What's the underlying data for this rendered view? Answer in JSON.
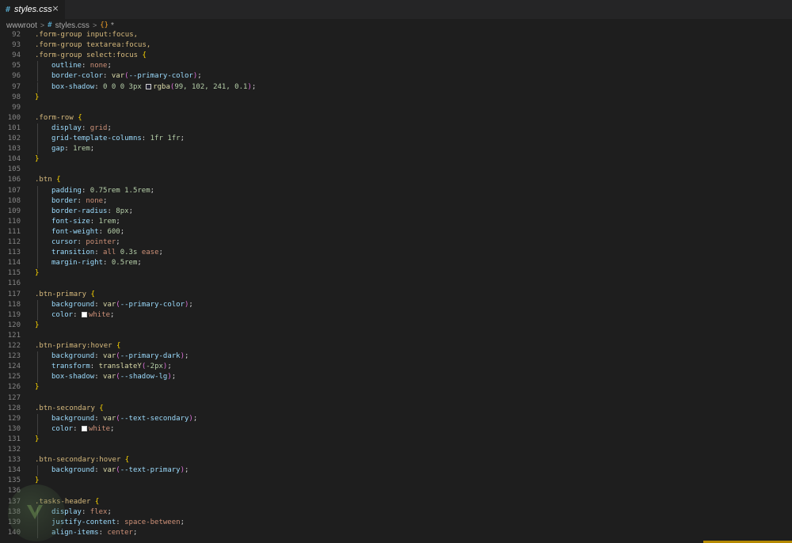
{
  "tab": {
    "icon": "#",
    "label": "styles.css",
    "close_icon": "×"
  },
  "breadcrumb": {
    "folder": "wwwroot",
    "file_icon": "#",
    "file": "styles.css",
    "symbol_icon": "{}",
    "symbol": "*",
    "separator": ">"
  },
  "colors": {
    "selector": "#d7ba7d",
    "property": "#9cdcfe",
    "value": "#ce9178",
    "number": "#b5cea8",
    "function": "#dcdcaa",
    "line_number": "#858585",
    "background": "#1e1e1e",
    "accent_bar": "#b58900"
  },
  "code_lines": [
    {
      "n": "92",
      "tokens": [
        {
          "t": ".form-group input:focus,",
          "c": "sel"
        }
      ]
    },
    {
      "n": "93",
      "tokens": [
        {
          "t": ".form-group textarea:focus,",
          "c": "sel"
        }
      ]
    },
    {
      "n": "94",
      "tokens": [
        {
          "t": ".form-group select:focus ",
          "c": "sel"
        },
        {
          "t": "{",
          "c": "b1"
        }
      ]
    },
    {
      "n": "95",
      "indent": true,
      "tokens": [
        {
          "t": "outline",
          "c": "prop"
        },
        {
          "t": ": ",
          "c": "punc"
        },
        {
          "t": "none",
          "c": "val"
        },
        {
          "t": ";",
          "c": "punc"
        }
      ]
    },
    {
      "n": "96",
      "indent": true,
      "tokens": [
        {
          "t": "border-color",
          "c": "prop"
        },
        {
          "t": ": ",
          "c": "punc"
        },
        {
          "t": "var",
          "c": "fn"
        },
        {
          "t": "(",
          "c": "b2"
        },
        {
          "t": "--primary-color",
          "c": "prop"
        },
        {
          "t": ")",
          "c": "b2"
        },
        {
          "t": ";",
          "c": "punc"
        }
      ]
    },
    {
      "n": "97",
      "indent": true,
      "tokens": [
        {
          "t": "box-shadow",
          "c": "prop"
        },
        {
          "t": ": ",
          "c": "punc"
        },
        {
          "t": "0 0 0 3px ",
          "c": "num"
        },
        {
          "swatch": "rgba(99,102,241,0.1)"
        },
        {
          "t": "rgba",
          "c": "fn"
        },
        {
          "t": "(",
          "c": "b2"
        },
        {
          "t": "99, 102, 241, 0.1",
          "c": "num"
        },
        {
          "t": ")",
          "c": "b2"
        },
        {
          "t": ";",
          "c": "punc"
        }
      ]
    },
    {
      "n": "98",
      "tokens": [
        {
          "t": "}",
          "c": "b1"
        }
      ]
    },
    {
      "n": "99",
      "tokens": []
    },
    {
      "n": "100",
      "tokens": [
        {
          "t": ".form-row ",
          "c": "sel"
        },
        {
          "t": "{",
          "c": "b1"
        }
      ]
    },
    {
      "n": "101",
      "indent": true,
      "tokens": [
        {
          "t": "display",
          "c": "prop"
        },
        {
          "t": ": ",
          "c": "punc"
        },
        {
          "t": "grid",
          "c": "val"
        },
        {
          "t": ";",
          "c": "punc"
        }
      ]
    },
    {
      "n": "102",
      "indent": true,
      "tokens": [
        {
          "t": "grid-template-columns",
          "c": "prop"
        },
        {
          "t": ": ",
          "c": "punc"
        },
        {
          "t": "1fr 1fr",
          "c": "num"
        },
        {
          "t": ";",
          "c": "punc"
        }
      ]
    },
    {
      "n": "103",
      "indent": true,
      "tokens": [
        {
          "t": "gap",
          "c": "prop"
        },
        {
          "t": ": ",
          "c": "punc"
        },
        {
          "t": "1rem",
          "c": "num"
        },
        {
          "t": ";",
          "c": "punc"
        }
      ]
    },
    {
      "n": "104",
      "tokens": [
        {
          "t": "}",
          "c": "b1"
        }
      ]
    },
    {
      "n": "105",
      "tokens": []
    },
    {
      "n": "106",
      "tokens": [
        {
          "t": ".btn ",
          "c": "sel"
        },
        {
          "t": "{",
          "c": "b1"
        }
      ]
    },
    {
      "n": "107",
      "indent": true,
      "tokens": [
        {
          "t": "padding",
          "c": "prop"
        },
        {
          "t": ": ",
          "c": "punc"
        },
        {
          "t": "0.75rem 1.5rem",
          "c": "num"
        },
        {
          "t": ";",
          "c": "punc"
        }
      ]
    },
    {
      "n": "108",
      "indent": true,
      "tokens": [
        {
          "t": "border",
          "c": "prop"
        },
        {
          "t": ": ",
          "c": "punc"
        },
        {
          "t": "none",
          "c": "val"
        },
        {
          "t": ";",
          "c": "punc"
        }
      ]
    },
    {
      "n": "109",
      "indent": true,
      "tokens": [
        {
          "t": "border-radius",
          "c": "prop"
        },
        {
          "t": ": ",
          "c": "punc"
        },
        {
          "t": "8px",
          "c": "num"
        },
        {
          "t": ";",
          "c": "punc"
        }
      ]
    },
    {
      "n": "110",
      "indent": true,
      "tokens": [
        {
          "t": "font-size",
          "c": "prop"
        },
        {
          "t": ": ",
          "c": "punc"
        },
        {
          "t": "1rem",
          "c": "num"
        },
        {
          "t": ";",
          "c": "punc"
        }
      ]
    },
    {
      "n": "111",
      "indent": true,
      "tokens": [
        {
          "t": "font-weight",
          "c": "prop"
        },
        {
          "t": ": ",
          "c": "punc"
        },
        {
          "t": "600",
          "c": "num"
        },
        {
          "t": ";",
          "c": "punc"
        }
      ]
    },
    {
      "n": "112",
      "indent": true,
      "tokens": [
        {
          "t": "cursor",
          "c": "prop"
        },
        {
          "t": ": ",
          "c": "punc"
        },
        {
          "t": "pointer",
          "c": "val"
        },
        {
          "t": ";",
          "c": "punc"
        }
      ]
    },
    {
      "n": "113",
      "indent": true,
      "tokens": [
        {
          "t": "transition",
          "c": "prop"
        },
        {
          "t": ": ",
          "c": "punc"
        },
        {
          "t": "all ",
          "c": "val"
        },
        {
          "t": "0.3s ",
          "c": "num"
        },
        {
          "t": "ease",
          "c": "val"
        },
        {
          "t": ";",
          "c": "punc"
        }
      ]
    },
    {
      "n": "114",
      "indent": true,
      "tokens": [
        {
          "t": "margin-right",
          "c": "prop"
        },
        {
          "t": ": ",
          "c": "punc"
        },
        {
          "t": "0.5rem",
          "c": "num"
        },
        {
          "t": ";",
          "c": "punc"
        }
      ]
    },
    {
      "n": "115",
      "tokens": [
        {
          "t": "}",
          "c": "b1"
        }
      ]
    },
    {
      "n": "116",
      "tokens": []
    },
    {
      "n": "117",
      "tokens": [
        {
          "t": ".btn-primary ",
          "c": "sel"
        },
        {
          "t": "{",
          "c": "b1"
        }
      ]
    },
    {
      "n": "118",
      "indent": true,
      "tokens": [
        {
          "t": "background",
          "c": "prop"
        },
        {
          "t": ": ",
          "c": "punc"
        },
        {
          "t": "var",
          "c": "fn"
        },
        {
          "t": "(",
          "c": "b2"
        },
        {
          "t": "--primary-color",
          "c": "prop"
        },
        {
          "t": ")",
          "c": "b2"
        },
        {
          "t": ";",
          "c": "punc"
        }
      ]
    },
    {
      "n": "119",
      "indent": true,
      "tokens": [
        {
          "t": "color",
          "c": "prop"
        },
        {
          "t": ": ",
          "c": "punc"
        },
        {
          "swatch": "#ffffff"
        },
        {
          "t": "white",
          "c": "val"
        },
        {
          "t": ";",
          "c": "punc"
        }
      ]
    },
    {
      "n": "120",
      "tokens": [
        {
          "t": "}",
          "c": "b1"
        }
      ]
    },
    {
      "n": "121",
      "tokens": []
    },
    {
      "n": "122",
      "tokens": [
        {
          "t": ".btn-primary:hover ",
          "c": "sel"
        },
        {
          "t": "{",
          "c": "b1"
        }
      ]
    },
    {
      "n": "123",
      "indent": true,
      "tokens": [
        {
          "t": "background",
          "c": "prop"
        },
        {
          "t": ": ",
          "c": "punc"
        },
        {
          "t": "var",
          "c": "fn"
        },
        {
          "t": "(",
          "c": "b2"
        },
        {
          "t": "--primary-dark",
          "c": "prop"
        },
        {
          "t": ")",
          "c": "b2"
        },
        {
          "t": ";",
          "c": "punc"
        }
      ]
    },
    {
      "n": "124",
      "indent": true,
      "tokens": [
        {
          "t": "transform",
          "c": "prop"
        },
        {
          "t": ": ",
          "c": "punc"
        },
        {
          "t": "translateY",
          "c": "fn"
        },
        {
          "t": "(",
          "c": "b2"
        },
        {
          "t": "-2px",
          "c": "num"
        },
        {
          "t": ")",
          "c": "b2"
        },
        {
          "t": ";",
          "c": "punc"
        }
      ]
    },
    {
      "n": "125",
      "indent": true,
      "tokens": [
        {
          "t": "box-shadow",
          "c": "prop"
        },
        {
          "t": ": ",
          "c": "punc"
        },
        {
          "t": "var",
          "c": "fn"
        },
        {
          "t": "(",
          "c": "b2"
        },
        {
          "t": "--shadow-lg",
          "c": "prop"
        },
        {
          "t": ")",
          "c": "b2"
        },
        {
          "t": ";",
          "c": "punc"
        }
      ]
    },
    {
      "n": "126",
      "tokens": [
        {
          "t": "}",
          "c": "b1"
        }
      ]
    },
    {
      "n": "127",
      "tokens": []
    },
    {
      "n": "128",
      "tokens": [
        {
          "t": ".btn-secondary ",
          "c": "sel"
        },
        {
          "t": "{",
          "c": "b1"
        }
      ]
    },
    {
      "n": "129",
      "indent": true,
      "tokens": [
        {
          "t": "background",
          "c": "prop"
        },
        {
          "t": ": ",
          "c": "punc"
        },
        {
          "t": "var",
          "c": "fn"
        },
        {
          "t": "(",
          "c": "b2"
        },
        {
          "t": "--text-secondary",
          "c": "prop"
        },
        {
          "t": ")",
          "c": "b2"
        },
        {
          "t": ";",
          "c": "punc"
        }
      ]
    },
    {
      "n": "130",
      "indent": true,
      "tokens": [
        {
          "t": "color",
          "c": "prop"
        },
        {
          "t": ": ",
          "c": "punc"
        },
        {
          "swatch": "#ffffff"
        },
        {
          "t": "white",
          "c": "val"
        },
        {
          "t": ";",
          "c": "punc"
        }
      ]
    },
    {
      "n": "131",
      "tokens": [
        {
          "t": "}",
          "c": "b1"
        }
      ]
    },
    {
      "n": "132",
      "tokens": []
    },
    {
      "n": "133",
      "tokens": [
        {
          "t": ".btn-secondary:hover ",
          "c": "sel"
        },
        {
          "t": "{",
          "c": "b1"
        }
      ]
    },
    {
      "n": "134",
      "indent": true,
      "tokens": [
        {
          "t": "background",
          "c": "prop"
        },
        {
          "t": ": ",
          "c": "punc"
        },
        {
          "t": "var",
          "c": "fn"
        },
        {
          "t": "(",
          "c": "b2"
        },
        {
          "t": "--text-primary",
          "c": "prop"
        },
        {
          "t": ")",
          "c": "b2"
        },
        {
          "t": ";",
          "c": "punc"
        }
      ]
    },
    {
      "n": "135",
      "tokens": [
        {
          "t": "}",
          "c": "b1"
        }
      ]
    },
    {
      "n": "136",
      "tokens": []
    },
    {
      "n": "137",
      "tokens": [
        {
          "t": ".tasks-header ",
          "c": "sel"
        },
        {
          "t": "{",
          "c": "b1"
        }
      ]
    },
    {
      "n": "138",
      "indent": true,
      "tokens": [
        {
          "t": "display",
          "c": "prop"
        },
        {
          "t": ": ",
          "c": "punc"
        },
        {
          "t": "flex",
          "c": "val"
        },
        {
          "t": ";",
          "c": "punc"
        }
      ]
    },
    {
      "n": "139",
      "indent": true,
      "tokens": [
        {
          "t": "justify-content",
          "c": "prop"
        },
        {
          "t": ": ",
          "c": "punc"
        },
        {
          "t": "space-between",
          "c": "val"
        },
        {
          "t": ";",
          "c": "punc"
        }
      ]
    },
    {
      "n": "140",
      "indent": true,
      "tokens": [
        {
          "t": "align-items",
          "c": "prop"
        },
        {
          "t": ": ",
          "c": "punc"
        },
        {
          "t": "center",
          "c": "val"
        },
        {
          "t": ";",
          "c": "punc"
        }
      ]
    }
  ]
}
